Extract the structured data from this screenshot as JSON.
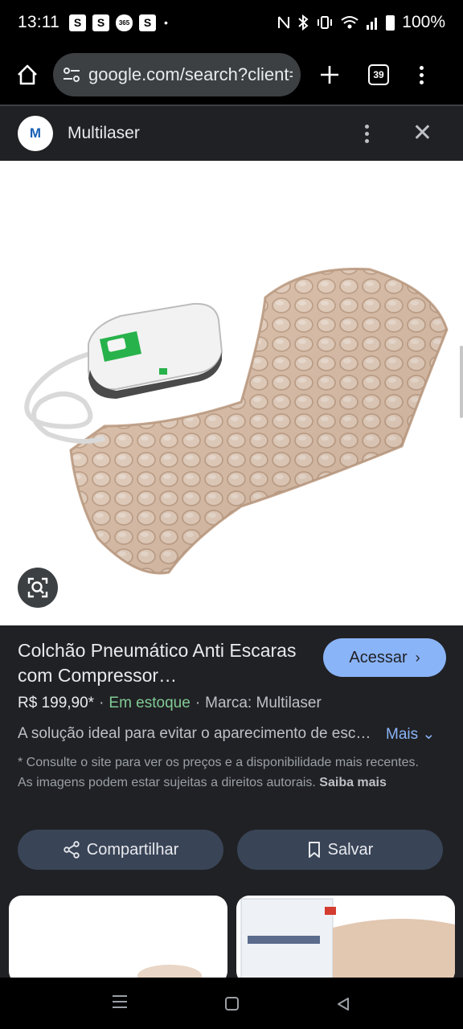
{
  "status_bar": {
    "time": "13:11",
    "notifications": [
      "S",
      "S",
      "365",
      "S"
    ],
    "dot": "•",
    "battery": "100%"
  },
  "browser": {
    "url": "google.com/search?client=ms-android-samsung",
    "tab_count": "39",
    "icons": [
      "home-icon",
      "tune-icon",
      "plus-icon",
      "tabs-icon",
      "menu-icon"
    ]
  },
  "source": {
    "logo_letter": "M",
    "name": "Multilaser",
    "icons": [
      "more-vert-icon",
      "close-icon"
    ],
    "close_glyph": "✕"
  },
  "image": {
    "lens_icon": "google-lens-icon"
  },
  "product": {
    "title": "Colchão Pneumático Anti Escaras com Compressor…",
    "open_label": "Acessar",
    "open_chevron": "›",
    "price": "R$ 199,90*",
    "stock": "Em estoque",
    "brand": "Marca: Multilaser",
    "separator": "·",
    "description": "A solução ideal para evitar o aparecimento de escaras",
    "more_label": "Mais",
    "more_chevron": "⌄",
    "disclaimer": "* Consulte o site para ver os preços e a disponibilidade mais recentes. As imagens podem estar sujeitas a direitos autorais. ",
    "learn_more": "Saiba mais",
    "share_label": "Compartilhar",
    "save_label": "Salvar"
  },
  "colors": {
    "background": "#202124",
    "accent": "#8ab4f8",
    "in_stock": "#81c995",
    "mattress": "#e4cbb6"
  }
}
